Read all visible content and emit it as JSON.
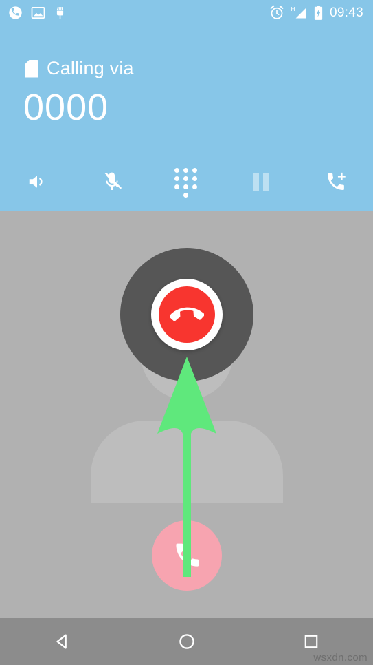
{
  "screen": {
    "name": "android-in-call-screen",
    "background_color": "#b1b1b1",
    "header_color": "#87c6e8"
  },
  "status_bar": {
    "time": "09:43",
    "left_icons": [
      {
        "name": "call-in-progress-icon",
        "label": "Ongoing call"
      },
      {
        "name": "screenshot-image-icon",
        "label": "Screenshot saved"
      },
      {
        "name": "usb-debugging-android-icon",
        "label": "USB debugging"
      }
    ],
    "right_icons": [
      {
        "name": "alarm-clock-icon",
        "label": "Alarm set"
      },
      {
        "name": "signal-h-icon",
        "label": "H"
      },
      {
        "name": "battery-charging-icon",
        "label": "Charging"
      }
    ]
  },
  "call_header": {
    "sim_icon_name": "sim-card-icon",
    "calling_via_label": "Calling via",
    "phone_number": "0000"
  },
  "controls": [
    {
      "name": "speaker-button",
      "label": "Speaker",
      "icon": "speaker-icon",
      "disabled": false
    },
    {
      "name": "mute-button",
      "label": "Mute",
      "icon": "mic-off-icon",
      "disabled": false
    },
    {
      "name": "keypad-button",
      "label": "Keypad",
      "icon": "dialpad-icon",
      "disabled": false
    },
    {
      "name": "hold-button",
      "label": "Hold",
      "icon": "pause-icon",
      "disabled": true
    },
    {
      "name": "add-call-button",
      "label": "Add call",
      "icon": "add-call-icon",
      "disabled": false
    }
  ],
  "call_body": {
    "avatar_name": "contact-avatar-silhouette",
    "end_call": {
      "name": "end-call-button",
      "label": "End call",
      "icon": "hang-up-phone-icon",
      "color": "#f8352f"
    },
    "answer": {
      "name": "answer-call-button",
      "label": "Answer",
      "icon": "phone-handset-icon",
      "color": "#f7a4b0"
    },
    "annotation": {
      "name": "green-arrow-annotation",
      "color": "#5fe87c",
      "direction": "up"
    }
  },
  "nav_bar": [
    {
      "name": "nav-back-button",
      "label": "Back"
    },
    {
      "name": "nav-home-button",
      "label": "Home"
    },
    {
      "name": "nav-recents-button",
      "label": "Recents"
    }
  ],
  "watermark": {
    "text": "wsxdn.com"
  }
}
